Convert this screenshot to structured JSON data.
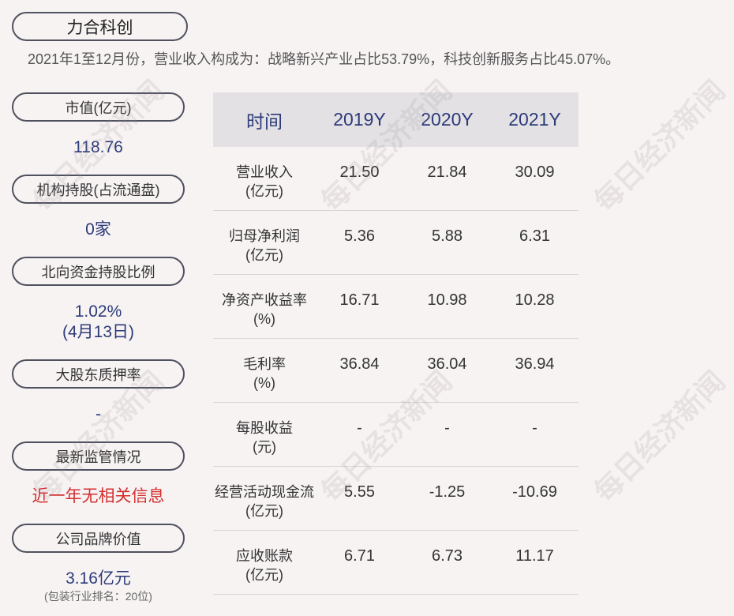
{
  "company": {
    "name": "力合科创"
  },
  "summary": "2021年1至12月份，营业收入构成为：战略新兴产业占比53.79%，科技创新服务占比45.07%。",
  "watermark": "每日经济新闻",
  "colors": {
    "page_background": "#f7f3f3",
    "pill_border": "#4f515e",
    "value_navy": "#2c3a79",
    "alert_red": "#d32f2f",
    "table_header_background": "#e3e1e4",
    "row_divider": "#d9d5d7",
    "watermark": "#9a9095"
  },
  "metrics": [
    {
      "label": "市值(亿元)",
      "value": "118.76"
    },
    {
      "label": "机构持股(占流通盘)",
      "value": "0家"
    },
    {
      "label": "北向资金持股比例",
      "value": "1.02%",
      "date": "(4月13日)"
    },
    {
      "label": "大股东质押率",
      "value": "-"
    },
    {
      "label": "最新监管情况",
      "value": "近一年无相关信息"
    },
    {
      "label": "公司品牌价值",
      "value": "3.16亿元",
      "ranking": "(包装行业排名：20位)"
    }
  ],
  "table": {
    "headers": [
      "时间",
      "2019Y",
      "2020Y",
      "2021Y"
    ],
    "rows": [
      {
        "label": "营业收入",
        "unit": "(亿元)",
        "values": [
          "21.50",
          "21.84",
          "30.09"
        ]
      },
      {
        "label": "归母净利润",
        "unit": "(亿元)",
        "values": [
          "5.36",
          "5.88",
          "6.31"
        ]
      },
      {
        "label": "净资产收益率",
        "unit": "(%)",
        "values": [
          "16.71",
          "10.98",
          "10.28"
        ]
      },
      {
        "label": "毛利率",
        "unit": "(%)",
        "values": [
          "36.84",
          "36.04",
          "36.94"
        ]
      },
      {
        "label": "每股收益",
        "unit": "(元)",
        "values": [
          "-",
          "-",
          "-"
        ]
      },
      {
        "label": "经营活动现金流",
        "unit": "(亿元)",
        "values": [
          "5.55",
          "-1.25",
          "-10.69"
        ]
      },
      {
        "label": "应收账款",
        "unit": "(亿元)",
        "values": [
          "6.71",
          "6.73",
          "11.17"
        ]
      }
    ]
  }
}
